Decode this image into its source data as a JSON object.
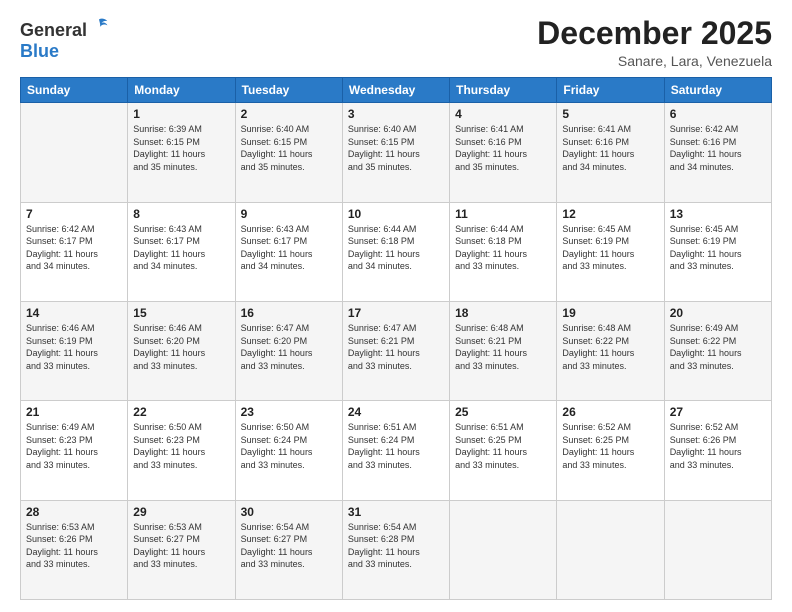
{
  "header": {
    "logo_general": "General",
    "logo_blue": "Blue",
    "month": "December 2025",
    "location": "Sanare, Lara, Venezuela"
  },
  "weekdays": [
    "Sunday",
    "Monday",
    "Tuesday",
    "Wednesday",
    "Thursday",
    "Friday",
    "Saturday"
  ],
  "weeks": [
    [
      {
        "day": "",
        "info": ""
      },
      {
        "day": "1",
        "info": "Sunrise: 6:39 AM\nSunset: 6:15 PM\nDaylight: 11 hours\nand 35 minutes."
      },
      {
        "day": "2",
        "info": "Sunrise: 6:40 AM\nSunset: 6:15 PM\nDaylight: 11 hours\nand 35 minutes."
      },
      {
        "day": "3",
        "info": "Sunrise: 6:40 AM\nSunset: 6:15 PM\nDaylight: 11 hours\nand 35 minutes."
      },
      {
        "day": "4",
        "info": "Sunrise: 6:41 AM\nSunset: 6:16 PM\nDaylight: 11 hours\nand 35 minutes."
      },
      {
        "day": "5",
        "info": "Sunrise: 6:41 AM\nSunset: 6:16 PM\nDaylight: 11 hours\nand 34 minutes."
      },
      {
        "day": "6",
        "info": "Sunrise: 6:42 AM\nSunset: 6:16 PM\nDaylight: 11 hours\nand 34 minutes."
      }
    ],
    [
      {
        "day": "7",
        "info": "Sunrise: 6:42 AM\nSunset: 6:17 PM\nDaylight: 11 hours\nand 34 minutes."
      },
      {
        "day": "8",
        "info": "Sunrise: 6:43 AM\nSunset: 6:17 PM\nDaylight: 11 hours\nand 34 minutes."
      },
      {
        "day": "9",
        "info": "Sunrise: 6:43 AM\nSunset: 6:17 PM\nDaylight: 11 hours\nand 34 minutes."
      },
      {
        "day": "10",
        "info": "Sunrise: 6:44 AM\nSunset: 6:18 PM\nDaylight: 11 hours\nand 34 minutes."
      },
      {
        "day": "11",
        "info": "Sunrise: 6:44 AM\nSunset: 6:18 PM\nDaylight: 11 hours\nand 33 minutes."
      },
      {
        "day": "12",
        "info": "Sunrise: 6:45 AM\nSunset: 6:19 PM\nDaylight: 11 hours\nand 33 minutes."
      },
      {
        "day": "13",
        "info": "Sunrise: 6:45 AM\nSunset: 6:19 PM\nDaylight: 11 hours\nand 33 minutes."
      }
    ],
    [
      {
        "day": "14",
        "info": "Sunrise: 6:46 AM\nSunset: 6:19 PM\nDaylight: 11 hours\nand 33 minutes."
      },
      {
        "day": "15",
        "info": "Sunrise: 6:46 AM\nSunset: 6:20 PM\nDaylight: 11 hours\nand 33 minutes."
      },
      {
        "day": "16",
        "info": "Sunrise: 6:47 AM\nSunset: 6:20 PM\nDaylight: 11 hours\nand 33 minutes."
      },
      {
        "day": "17",
        "info": "Sunrise: 6:47 AM\nSunset: 6:21 PM\nDaylight: 11 hours\nand 33 minutes."
      },
      {
        "day": "18",
        "info": "Sunrise: 6:48 AM\nSunset: 6:21 PM\nDaylight: 11 hours\nand 33 minutes."
      },
      {
        "day": "19",
        "info": "Sunrise: 6:48 AM\nSunset: 6:22 PM\nDaylight: 11 hours\nand 33 minutes."
      },
      {
        "day": "20",
        "info": "Sunrise: 6:49 AM\nSunset: 6:22 PM\nDaylight: 11 hours\nand 33 minutes."
      }
    ],
    [
      {
        "day": "21",
        "info": "Sunrise: 6:49 AM\nSunset: 6:23 PM\nDaylight: 11 hours\nand 33 minutes."
      },
      {
        "day": "22",
        "info": "Sunrise: 6:50 AM\nSunset: 6:23 PM\nDaylight: 11 hours\nand 33 minutes."
      },
      {
        "day": "23",
        "info": "Sunrise: 6:50 AM\nSunset: 6:24 PM\nDaylight: 11 hours\nand 33 minutes."
      },
      {
        "day": "24",
        "info": "Sunrise: 6:51 AM\nSunset: 6:24 PM\nDaylight: 11 hours\nand 33 minutes."
      },
      {
        "day": "25",
        "info": "Sunrise: 6:51 AM\nSunset: 6:25 PM\nDaylight: 11 hours\nand 33 minutes."
      },
      {
        "day": "26",
        "info": "Sunrise: 6:52 AM\nSunset: 6:25 PM\nDaylight: 11 hours\nand 33 minutes."
      },
      {
        "day": "27",
        "info": "Sunrise: 6:52 AM\nSunset: 6:26 PM\nDaylight: 11 hours\nand 33 minutes."
      }
    ],
    [
      {
        "day": "28",
        "info": "Sunrise: 6:53 AM\nSunset: 6:26 PM\nDaylight: 11 hours\nand 33 minutes."
      },
      {
        "day": "29",
        "info": "Sunrise: 6:53 AM\nSunset: 6:27 PM\nDaylight: 11 hours\nand 33 minutes."
      },
      {
        "day": "30",
        "info": "Sunrise: 6:54 AM\nSunset: 6:27 PM\nDaylight: 11 hours\nand 33 minutes."
      },
      {
        "day": "31",
        "info": "Sunrise: 6:54 AM\nSunset: 6:28 PM\nDaylight: 11 hours\nand 33 minutes."
      },
      {
        "day": "",
        "info": ""
      },
      {
        "day": "",
        "info": ""
      },
      {
        "day": "",
        "info": ""
      }
    ]
  ]
}
